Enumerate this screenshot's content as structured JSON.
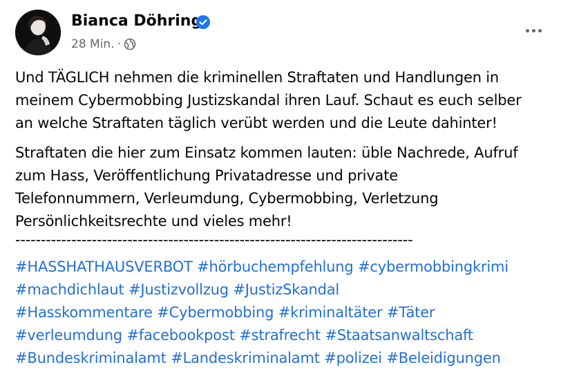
{
  "author": {
    "name": "Bianca Döhring",
    "verified_icon": "verified-badge-icon",
    "timestamp": "28 Min.",
    "separator_dot": "·",
    "audience_icon": "globe-icon"
  },
  "menu": {
    "more_icon": "more-options-icon"
  },
  "post": {
    "paragraph1": "Und TÄGLICH nehmen die kriminellen Straftaten und Handlungen in\nmeinem Cybermobbing Justizskandal ihren Lauf. Schaut es euch selber\nan welche Straftaten täglich verübt werden und die Leute dahinter!",
    "paragraph2": "Straftaten die hier zum Einsatz kommen lauten: üble Nachrede, Aufruf\nzum Hass, Veröffentlichung Privatadresse und private\nTelefonnummern, Verleumdung, Cybermobbing, Verletzung\nPersönlichkeitsrechte und vieles mehr!",
    "separator": "------------------------------------------------------------------------------"
  },
  "hashtag_lines": [
    [
      "#HASSHATHAUSVERBOT",
      "#hörbuchempfehlung",
      "#cybermobbingkrimi"
    ],
    [
      "#machdichlaut",
      "#Justizvollzug",
      "#JustizSkandal"
    ],
    [
      "#Hasskommentare",
      "#Cybermobbing",
      "#kriminaltäter",
      "#Täter"
    ],
    [
      "#verleumdung",
      "#facebookpost",
      "#strafrecht",
      "#Staatsanwaltschaft"
    ],
    [
      "#Bundeskriminalamt",
      "#Landeskriminalamt",
      "#polizei",
      "#Beleidigungen"
    ]
  ],
  "colors": {
    "hashtag": "#216fdb",
    "verified": "#1877f2",
    "meta": "#65676b",
    "text": "#050505"
  }
}
